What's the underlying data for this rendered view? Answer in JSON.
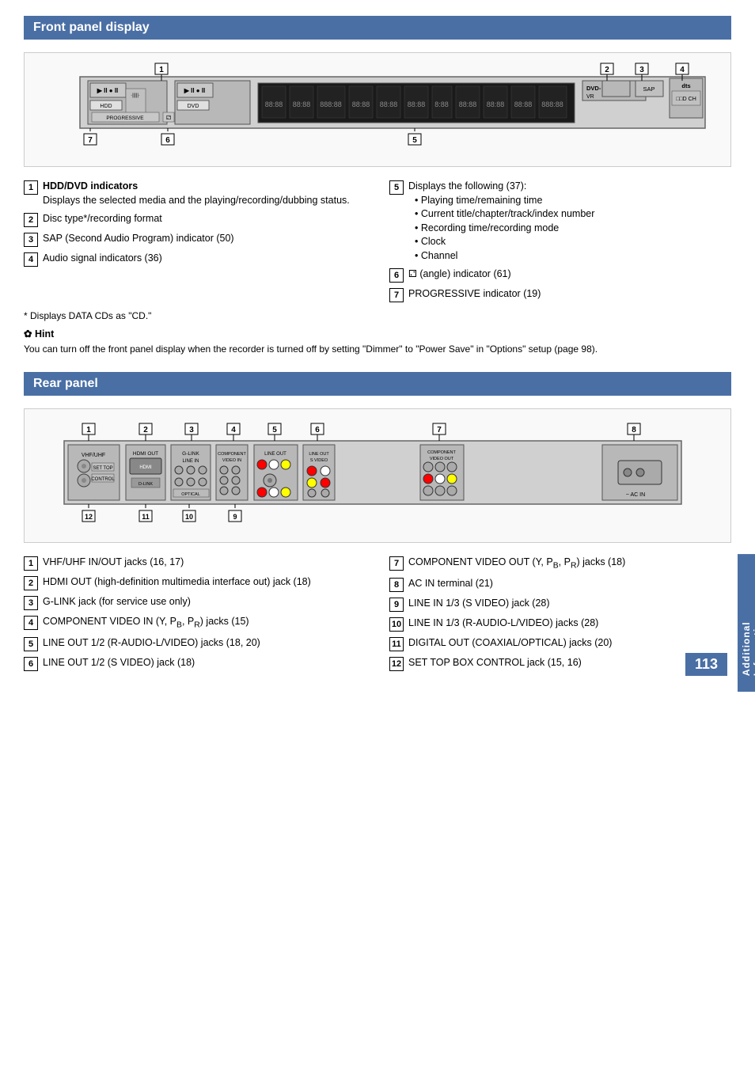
{
  "page": {
    "number": "113",
    "side_tab": "Additional Information"
  },
  "front_panel": {
    "section_title": "Front panel display",
    "items": [
      {
        "num": "1",
        "title": "HDD/DVD indicators",
        "desc": "Displays the selected media and the playing/recording/dubbing status."
      },
      {
        "num": "2",
        "title": "Disc type*/recording format",
        "desc": ""
      },
      {
        "num": "3",
        "title": "SAP (Second Audio Program) indicator (50)",
        "desc": ""
      },
      {
        "num": "4",
        "title": "Audio signal indicators (36)",
        "desc": ""
      },
      {
        "num": "5",
        "title": "Displays the following (37):",
        "sub": [
          "Playing time/remaining time",
          "Current title/chapter/track/index number",
          "Recording time/recording mode",
          "Clock",
          "Channel"
        ]
      },
      {
        "num": "6",
        "title": "(angle) indicator (61)",
        "desc": ""
      },
      {
        "num": "7",
        "title": "PROGRESSIVE indicator (19)",
        "desc": ""
      }
    ],
    "footnote": "* Displays DATA CDs as \"CD.\"",
    "hint_title": "Hint",
    "hint_text": "You can turn off the front panel display when the recorder is turned off by setting \"Dimmer\" to \"Power Save\" in \"Options\" setup (page 98)."
  },
  "rear_panel": {
    "section_title": "Rear panel",
    "items": [
      {
        "num": "1",
        "title": "VHF/UHF IN/OUT jacks (16, 17)"
      },
      {
        "num": "2",
        "title": "HDMI OUT (high-definition multimedia interface out) jack (18)"
      },
      {
        "num": "3",
        "title": "G-LINK jack (for service use only)"
      },
      {
        "num": "4",
        "title": "COMPONENT VIDEO IN (Y, PB, PR) jacks (15)"
      },
      {
        "num": "5",
        "title": "LINE OUT 1/2 (R-AUDIO-L/VIDEO) jacks (18, 20)"
      },
      {
        "num": "6",
        "title": "LINE OUT 1/2 (S VIDEO) jack (18)"
      },
      {
        "num": "7",
        "title": "COMPONENT VIDEO OUT (Y, PB, PR) jacks (18)"
      },
      {
        "num": "8",
        "title": "AC IN terminal (21)"
      },
      {
        "num": "9",
        "title": "LINE IN 1/3 (S VIDEO) jack (28)"
      },
      {
        "num": "10",
        "title": "LINE IN 1/3 (R-AUDIO-L/VIDEO) jacks (28)"
      },
      {
        "num": "11",
        "title": "DIGITAL OUT (COAXIAL/OPTICAL) jacks (20)"
      },
      {
        "num": "12",
        "title": "SET TOP BOX CONTROL jack (15, 16)"
      }
    ]
  }
}
